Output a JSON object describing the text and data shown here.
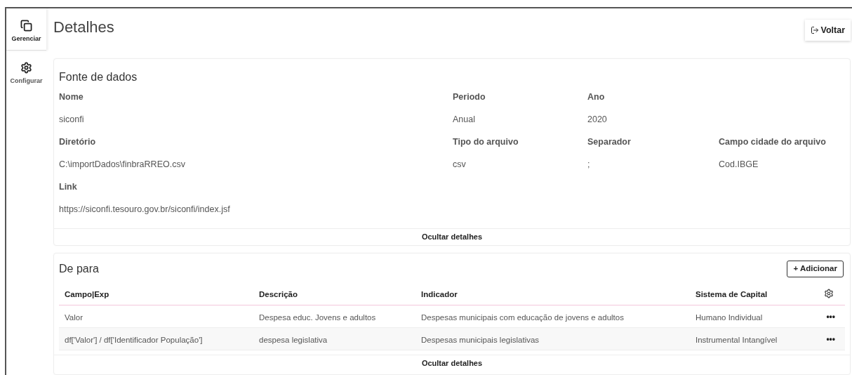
{
  "sidebar": {
    "items": [
      {
        "label": "Gerenciar",
        "selected": true
      },
      {
        "label": "Configurar",
        "selected": false
      }
    ]
  },
  "page": {
    "title": "Detalhes",
    "back_button": "Voltar"
  },
  "source": {
    "title": "Fonte de dados",
    "fields": [
      {
        "label": "Nome",
        "value": "siconfi"
      },
      {
        "label": "Periodo",
        "value": "Anual"
      },
      {
        "label": "Ano",
        "value": "2020"
      },
      {
        "label": "Diretório",
        "value": "C:\\importDados\\finbraRREO.csv"
      },
      {
        "label": "Tipo do arquivo",
        "value": "csv"
      },
      {
        "label": "Separador",
        "value": ";"
      },
      {
        "label": "Campo cidade do arquivo",
        "value": "Cod.IBGE"
      },
      {
        "label": "Link",
        "value": "https://siconfi.tesouro.gov.br/siconfi/index.jsf"
      }
    ],
    "toggle": "Ocultar detalhes"
  },
  "mapping": {
    "title": "De para",
    "add_button": "+ Adicionar",
    "table": {
      "columns": [
        "Campo|Exp",
        "Descrição",
        "Indicador",
        "Sistema de Capital"
      ],
      "rows": [
        [
          "Valor",
          "Despesa educ. Jovens e adultos",
          "Despesas municipais com educação de jovens e adultos",
          "Humano Individual"
        ],
        [
          "df['Valor'] / df['Identificador População']",
          "despesa legislativa",
          "Despesas municipais legislativas",
          "Instrumental Intangível"
        ]
      ],
      "row_action": "•••"
    },
    "toggle": "Ocultar detalhes"
  }
}
